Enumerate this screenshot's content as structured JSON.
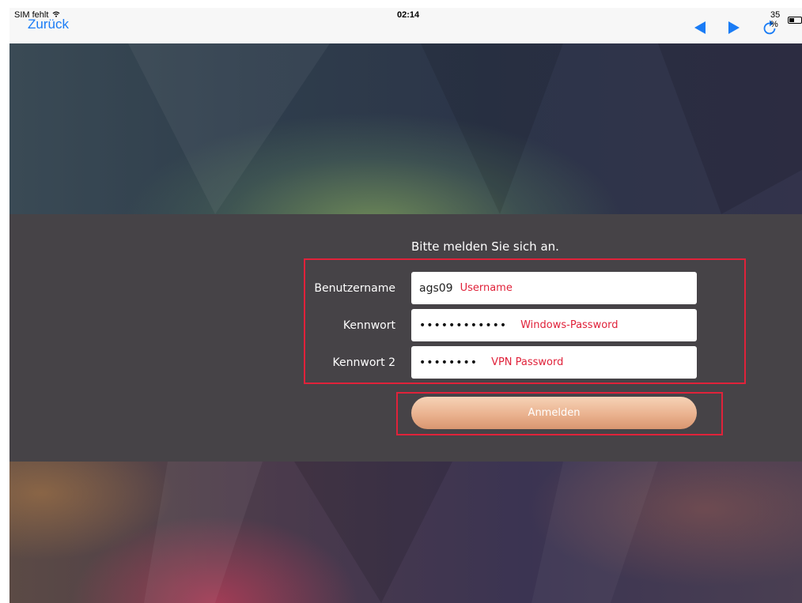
{
  "status_bar": {
    "carrier": "SIM fehlt",
    "back_label": "Zurück",
    "time": "02:14",
    "battery": "35 %",
    "icons": {
      "wifi": "wifi-icon",
      "prev": "arrow-left-icon",
      "next": "arrow-right-icon",
      "reload": "reload-icon",
      "battery": "battery-icon"
    },
    "accent_color": "#1a7cf5"
  },
  "login": {
    "title": "Bitte melden Sie sich an.",
    "username_label": "Benutzername",
    "username_value": "ags09",
    "password_label": "Kennwort",
    "password_value": "••••••••••••",
    "password2_label": "Kennwort 2",
    "password2_value": "••••••••",
    "submit_label": "Anmelden"
  },
  "annotations": {
    "username_note": "Username",
    "password_note": "Windows-Password",
    "password2_note": "VPN Password",
    "color": "#e0223a"
  }
}
